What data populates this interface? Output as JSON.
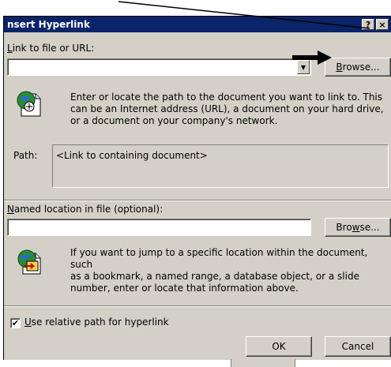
{
  "window": {
    "title": "nsert Hyperlink",
    "help_button": "?",
    "close_button": "×"
  },
  "link_section": {
    "label": "ink to file or URL:",
    "label_accel": "L",
    "url_value": "",
    "browse_label": "rowse...",
    "browse_accel": "B",
    "description_lines": [
      "Enter or locate the path to the document you want to link to.  This",
      "can be an Internet address (URL), a document on your hard drive,",
      "or a document on your company's network."
    ],
    "path_label": "Path:",
    "path_value": "<Link to containing document>"
  },
  "named_section": {
    "label": "amed location in file (optional):",
    "label_accel": "N",
    "value": "",
    "browse_label_pre": "Bro",
    "browse_accel": "w",
    "browse_label_post": "se...",
    "description_lines": [
      "If you want to jump to a specific location within the document, such",
      "as a bookmark, a named range, a database object, or a slide",
      "number, enter or locate that information above."
    ]
  },
  "options": {
    "relative_path_accel": "U",
    "relative_path_label": "se relative path for hyperlink",
    "relative_path_checked": true,
    "checkmark": "✔"
  },
  "buttons": {
    "ok": "OK",
    "cancel": "Cancel"
  },
  "icons": {
    "link_icon": "document-link-icon",
    "named_icon": "document-location-icon",
    "annotation": "annotation-arrow"
  }
}
